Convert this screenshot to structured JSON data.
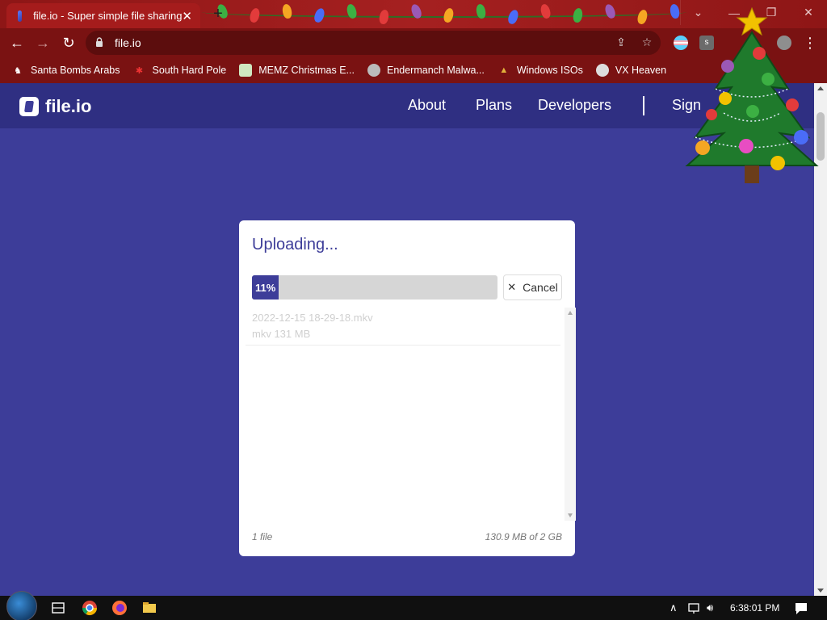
{
  "browser": {
    "tab_title": "file.io - Super simple file sharing",
    "url": "file.io",
    "bookmarks": [
      {
        "label": "Santa Bombs Arabs",
        "icon": "santa-icon"
      },
      {
        "label": "South Hard Pole",
        "icon": "snowflake-icon"
      },
      {
        "label": "MEMZ Christmas E...",
        "icon": "memz-icon"
      },
      {
        "label": "Endermanch Malwa...",
        "icon": "endermanch-icon"
      },
      {
        "label": "Windows ISOs",
        "icon": "tree-icon"
      },
      {
        "label": "VX Heaven",
        "icon": "vx-icon"
      }
    ]
  },
  "site": {
    "logo_text": "file.io",
    "nav": [
      "About",
      "Plans",
      "Developers",
      "Sign"
    ]
  },
  "upload": {
    "heading": "Uploading...",
    "progress_label": "11%",
    "progress_value": 0.11,
    "cancel_label": "Cancel",
    "file_name": "2022-12-15 18-29-18.mkv",
    "file_meta": "mkv 131 MB",
    "file_count": "1 file",
    "size_summary": "130.9 MB of 2 GB"
  },
  "taskbar": {
    "clock": "6:38:01 PM"
  },
  "colors": {
    "brand": "#3d3d99",
    "chrome": "#7a1212"
  }
}
